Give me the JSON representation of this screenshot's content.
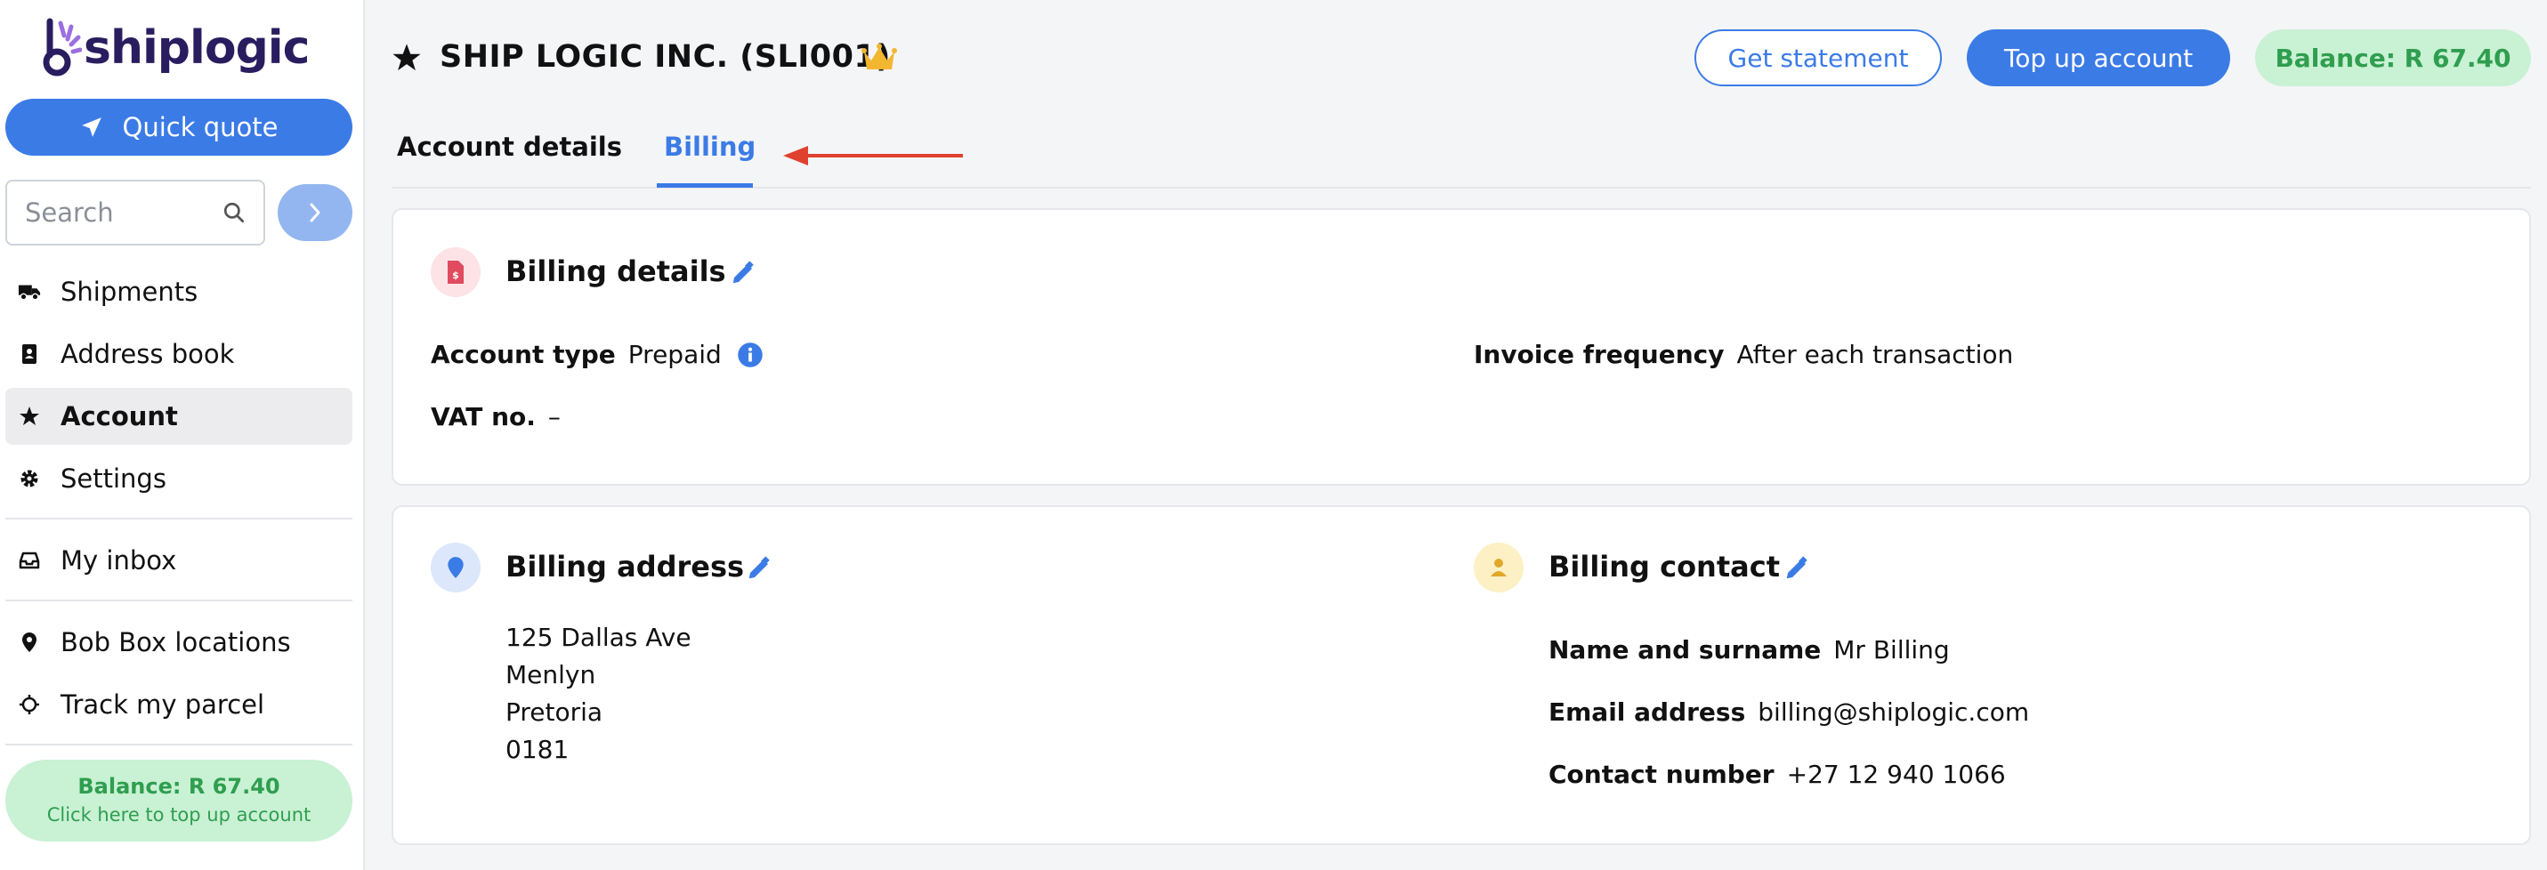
{
  "brand": {
    "name": "shiplogic"
  },
  "sidebar": {
    "quick_quote": "Quick quote",
    "search_placeholder": "Search",
    "nav": [
      {
        "label": "Shipments",
        "icon": "truck-icon"
      },
      {
        "label": "Address book",
        "icon": "address-book-icon"
      },
      {
        "label": "Account",
        "icon": "star-icon",
        "active": true
      },
      {
        "label": "Settings",
        "icon": "gear-icon"
      },
      {
        "label": "My inbox",
        "icon": "inbox-icon"
      },
      {
        "label": "Bob Box locations",
        "icon": "map-pin-icon"
      },
      {
        "label": "Track my parcel",
        "icon": "crosshair-icon"
      }
    ],
    "balance": {
      "amount": "Balance: R 67.40",
      "hint": "Click here to top up account"
    }
  },
  "header": {
    "title": "SHIP LOGIC INC. (SLI001)",
    "get_statement": "Get statement",
    "top_up": "Top up account",
    "balance": "Balance: R 67.40"
  },
  "tabs": [
    {
      "label": "Account details",
      "active": false
    },
    {
      "label": "Billing",
      "active": true
    }
  ],
  "billing_details": {
    "title": "Billing details",
    "account_type_label": "Account type",
    "account_type_value": "Prepaid",
    "invoice_frequency_label": "Invoice frequency",
    "invoice_frequency_value": "After each transaction",
    "vat_label": "VAT no.",
    "vat_value": "–"
  },
  "billing_address": {
    "title": "Billing address",
    "lines": [
      "125 Dallas Ave",
      "Menlyn",
      "Pretoria",
      "0181"
    ]
  },
  "billing_contact": {
    "title": "Billing contact",
    "name_label": "Name and surname",
    "name_value": "Mr Billing",
    "email_label": "Email address",
    "email_value": "billing@shiplogic.com",
    "phone_label": "Contact number",
    "phone_value": "+27 12 940 1066"
  },
  "colors": {
    "accent": "#3b7be6",
    "balance_bg": "#c9f1d4",
    "balance_text": "#2f9e4f",
    "arrow": "#e0412e"
  }
}
